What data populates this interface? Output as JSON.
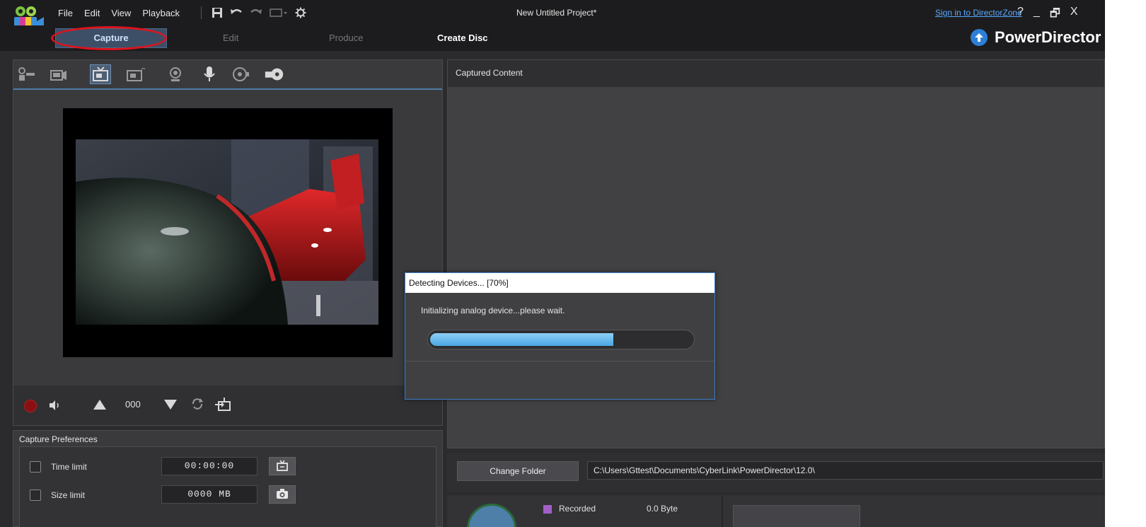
{
  "menu": {
    "file": "File",
    "edit": "Edit",
    "view": "View",
    "playback": "Playback"
  },
  "window": {
    "title": "New Untitled Project*",
    "sign_in": "Sign in to DirectorZone",
    "help": "?",
    "minimize": "_",
    "restore": "🗗",
    "close": "X"
  },
  "modes": {
    "capture": "Capture",
    "edit": "Edit",
    "produce": "Produce",
    "create_disc": "Create Disc"
  },
  "brand": {
    "name": "PowerDirector"
  },
  "capture_sources": [
    "webcam-icon",
    "dv-camcorder-icon",
    "tv-icon",
    "digital-tv-icon",
    "webcam-capture-icon",
    "microphone-icon",
    "cd-icon",
    "optical-disc-icon"
  ],
  "playback_controls": {
    "channel": "000"
  },
  "capture_preferences": {
    "title": "Capture Preferences",
    "time_limit_label": "Time limit",
    "time_limit_value": "00:00:00",
    "size_limit_label": "Size limit",
    "size_limit_value": "0000 MB"
  },
  "captured_content": {
    "title": "Captured Content"
  },
  "folder": {
    "change_button": "Change Folder",
    "path": "C:\\Users\\Gttest\\Documents\\CyberLink\\PowerDirector\\12.0\\"
  },
  "disk": {
    "recorded_label": "Recorded",
    "recorded_value": "0.0 Byte"
  },
  "dialog": {
    "title": "Detecting Devices... [70%]",
    "message": "Initializing analog device...please wait.",
    "progress_percent": 70
  },
  "colors": {
    "accent": "#4aa6e3",
    "highlight_circle": "#e0121b",
    "brand_icon": "#2d7fd6"
  }
}
